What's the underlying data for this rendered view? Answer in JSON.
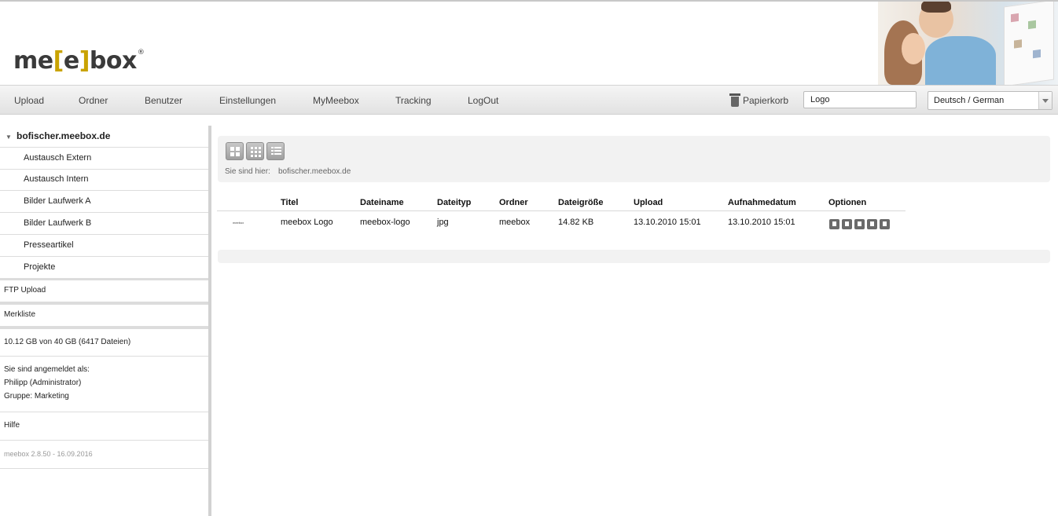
{
  "brand": {
    "logo_part1": "me",
    "logo_bracket_open": "[",
    "logo_e": "e",
    "logo_bracket_close": "]",
    "logo_part2": "box",
    "logo_reg": "®",
    "accent_color": "#c9a300"
  },
  "nav": {
    "items": [
      "Upload",
      "Ordner",
      "Benutzer",
      "Einstellungen",
      "MyMeebox",
      "Tracking",
      "LogOut"
    ],
    "papierkorb": "Papierkorb",
    "search_value": "Logo",
    "language": "Deutsch / German"
  },
  "sidebar": {
    "root": "bofischer.meebox.de",
    "folders": [
      "Austausch Extern",
      "Austausch Intern",
      "Bilder Laufwerk A",
      "Bilder Laufwerk B",
      "Presseartikel",
      "Projekte"
    ],
    "ftp_upload": "FTP Upload",
    "merkliste": "Merkliste",
    "quota": "10.12 GB von 40 GB (6417 Dateien)",
    "logged_in_label": "Sie sind angemeldet als:",
    "user": "Philipp (Administrator)",
    "group": "Gruppe: Marketing",
    "help": "Hilfe",
    "version": "meebox 2.8.50 - 16.09.2016"
  },
  "breadcrumb": {
    "label": "Sie sind hier:",
    "path": "bofischer.meebox.de"
  },
  "table": {
    "headers": [
      "Titel",
      "Dateiname",
      "Dateityp",
      "Ordner",
      "Dateigröße",
      "Upload",
      "Aufnahmedatum",
      "Optionen"
    ],
    "rows": [
      {
        "thumb": "meebox",
        "cells": [
          "meebox Logo",
          "meebox-logo",
          "jpg",
          "meebox",
          "14.82 KB",
          "13.10.2010 15:01",
          "13.10.2010 15:01"
        ]
      }
    ],
    "option_icons": [
      "download-icon",
      "edit-icon",
      "check-icon",
      "lock-icon",
      "delete-icon"
    ]
  }
}
